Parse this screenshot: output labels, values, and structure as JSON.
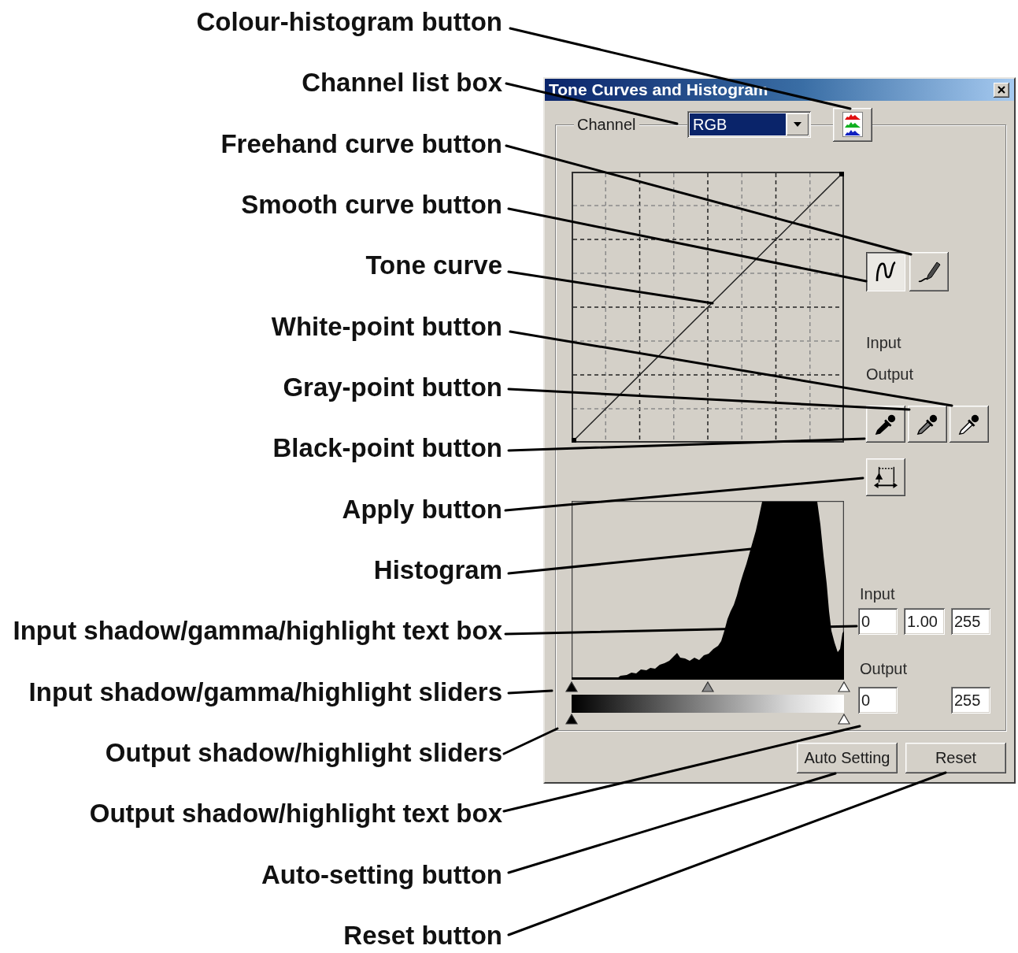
{
  "callouts": [
    "Colour-histogram button",
    "Channel list box",
    "Freehand curve button",
    "Smooth curve button",
    "Tone curve",
    "White-point button",
    "Gray-point button",
    "Black-point button",
    "Apply button",
    "Histogram",
    "Input shadow/gamma/highlight text box",
    "Input shadow/gamma/highlight sliders",
    "Output shadow/highlight sliders",
    "Output shadow/highlight text box",
    "Auto-setting button",
    "Reset button"
  ],
  "dialog": {
    "title": "Tone Curves and Histogram",
    "channel": {
      "label": "Channel",
      "value": "RGB"
    },
    "curve_buttons": [
      {
        "kind": "smooth",
        "selected": true
      },
      {
        "kind": "freehand",
        "selected": false
      }
    ],
    "curve_readout": {
      "input_label": "Input",
      "output_label": "Output"
    },
    "point_buttons": [
      {
        "kind": "shadow"
      },
      {
        "kind": "midtone"
      },
      {
        "kind": "highlight"
      }
    ],
    "input": {
      "label": "Input",
      "values": [
        "0",
        "1.00",
        "255"
      ]
    },
    "input_sliders": [
      {
        "kind": "shadow",
        "level": 0
      },
      {
        "kind": "gamma",
        "level": 0.5
      },
      {
        "kind": "highlight",
        "level": 1
      }
    ],
    "output": {
      "label": "Output",
      "values": [
        "0",
        "255"
      ]
    },
    "output_sliders": [
      {
        "kind": "shadow",
        "level": 0
      },
      {
        "kind": "highlight",
        "level": 1
      }
    ],
    "buttons": [
      "Auto Setting",
      "Reset"
    ]
  }
}
